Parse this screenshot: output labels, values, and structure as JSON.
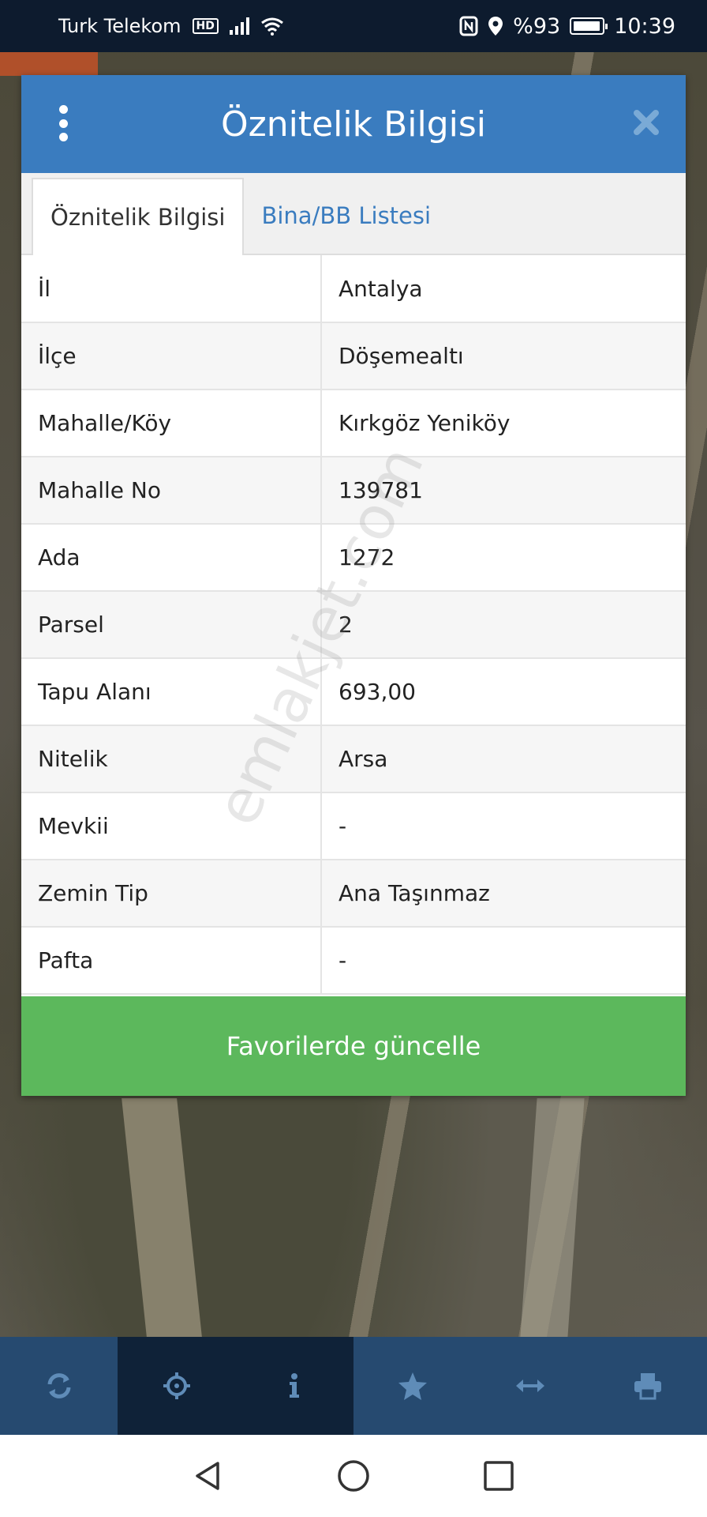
{
  "status_bar": {
    "carrier": "Turk Telekom",
    "hd": "HD",
    "battery": "%93",
    "time": "10:39"
  },
  "dialog": {
    "title": "Öznitelik Bilgisi",
    "tabs": [
      {
        "label": "Öznitelik Bilgisi",
        "active": true
      },
      {
        "label": "Bina/BB Listesi",
        "active": false
      }
    ],
    "rows": [
      {
        "key": "İl",
        "value": "Antalya"
      },
      {
        "key": "İlçe",
        "value": "Döşemealtı"
      },
      {
        "key": "Mahalle/Köy",
        "value": "Kırkgöz Yeniköy"
      },
      {
        "key": "Mahalle No",
        "value": "139781"
      },
      {
        "key": "Ada",
        "value": "1272"
      },
      {
        "key": "Parsel",
        "value": "2"
      },
      {
        "key": "Tapu Alanı",
        "value": "693,00"
      },
      {
        "key": "Nitelik",
        "value": "Arsa"
      },
      {
        "key": "Mevkii",
        "value": "-"
      },
      {
        "key": "Zemin Tip",
        "value": "Ana Taşınmaz"
      },
      {
        "key": "Pafta",
        "value": "-"
      }
    ],
    "button_label": "Favorilerde güncelle"
  },
  "watermark": "emlakjet.com",
  "toolbar": {
    "icons": [
      "refresh-icon",
      "crosshair-icon",
      "info-icon",
      "star-icon",
      "measure-icon",
      "print-icon"
    ]
  },
  "colors": {
    "header": "#3a7cbf",
    "button": "#5cb85c",
    "toolbar": "#264a70",
    "toolbar_active": "#0f2238"
  }
}
